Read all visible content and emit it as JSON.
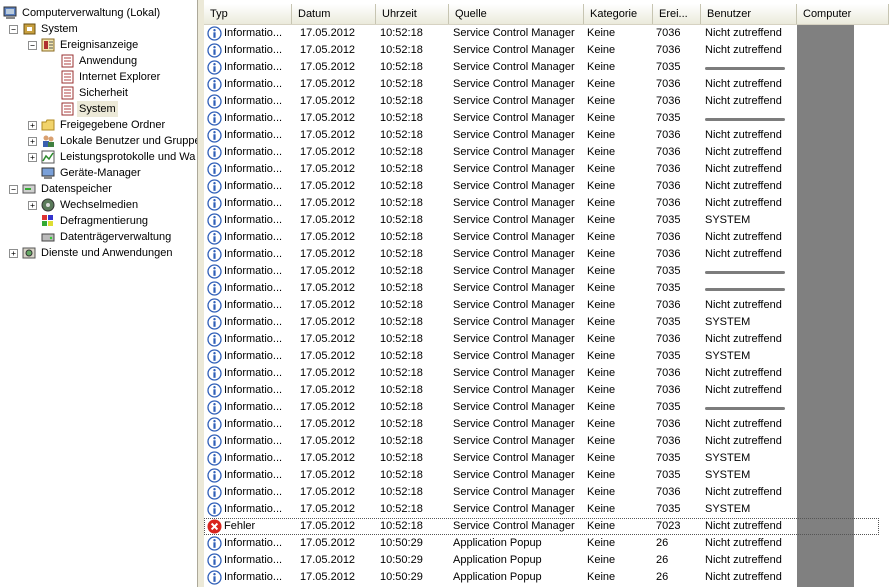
{
  "tree": {
    "items": [
      {
        "label": "Computerverwaltung (Lokal)",
        "icon": "computer-icon",
        "expander": "",
        "level": 0,
        "selected": false
      },
      {
        "label": "System",
        "icon": "tools-icon",
        "expander": "-",
        "level": 1,
        "selected": false
      },
      {
        "label": "Ereignisanzeige",
        "icon": "event-viewer-icon",
        "expander": "-",
        "level": 2,
        "selected": false
      },
      {
        "label": "Anwendung",
        "icon": "log-icon",
        "expander": "",
        "level": 3,
        "selected": false
      },
      {
        "label": "Internet Explorer",
        "icon": "log-icon",
        "expander": "",
        "level": 3,
        "selected": false
      },
      {
        "label": "Sicherheit",
        "icon": "log-icon",
        "expander": "",
        "level": 3,
        "selected": false
      },
      {
        "label": "System",
        "icon": "log-icon",
        "expander": "",
        "level": 3,
        "selected": true
      },
      {
        "label": "Freigegebene Ordner",
        "icon": "folder-icon",
        "expander": "+",
        "level": 2,
        "selected": false
      },
      {
        "label": "Lokale Benutzer und Gruppe",
        "icon": "users-icon",
        "expander": "+",
        "level": 2,
        "selected": false
      },
      {
        "label": "Leistungsprotokolle und Wa",
        "icon": "performance-icon",
        "expander": "+",
        "level": 2,
        "selected": false
      },
      {
        "label": "Geräte-Manager",
        "icon": "device-manager-icon",
        "expander": "",
        "level": 2,
        "selected": false
      },
      {
        "label": "Datenspeicher",
        "icon": "storage-icon",
        "expander": "-",
        "level": 1,
        "selected": false
      },
      {
        "label": "Wechselmedien",
        "icon": "removable-media-icon",
        "expander": "+",
        "level": 2,
        "selected": false
      },
      {
        "label": "Defragmentierung",
        "icon": "defrag-icon",
        "expander": "",
        "level": 2,
        "selected": false
      },
      {
        "label": "Datenträgerverwaltung",
        "icon": "disk-management-icon",
        "expander": "",
        "level": 2,
        "selected": false
      },
      {
        "label": "Dienste und Anwendungen",
        "icon": "services-icon",
        "expander": "+",
        "level": 1,
        "selected": false
      }
    ]
  },
  "list": {
    "columns": [
      {
        "key": "typ",
        "label": "Typ"
      },
      {
        "key": "datum",
        "label": "Datum"
      },
      {
        "key": "uhrzeit",
        "label": "Uhrzeit"
      },
      {
        "key": "quelle",
        "label": "Quelle"
      },
      {
        "key": "kategorie",
        "label": "Kategorie"
      },
      {
        "key": "ereignis",
        "label": "Erei..."
      },
      {
        "key": "benutzer",
        "label": "Benutzer"
      },
      {
        "key": "computer",
        "label": "Computer"
      }
    ],
    "rows": [
      {
        "typ": "Informatio...",
        "kind": "info",
        "datum": "17.05.2012",
        "uhrzeit": "10:52:18",
        "quelle": "Service Control Manager",
        "kategorie": "Keine",
        "ereignis": "7036",
        "benutzer": "Nicht zutreffend"
      },
      {
        "typ": "Informatio...",
        "kind": "info",
        "datum": "17.05.2012",
        "uhrzeit": "10:52:18",
        "quelle": "Service Control Manager",
        "kategorie": "Keine",
        "ereignis": "7036",
        "benutzer": "Nicht zutreffend"
      },
      {
        "typ": "Informatio...",
        "kind": "info",
        "datum": "17.05.2012",
        "uhrzeit": "10:52:18",
        "quelle": "Service Control Manager",
        "kategorie": "Keine",
        "ereignis": "7035",
        "benutzer": "",
        "redacted": true
      },
      {
        "typ": "Informatio...",
        "kind": "info",
        "datum": "17.05.2012",
        "uhrzeit": "10:52:18",
        "quelle": "Service Control Manager",
        "kategorie": "Keine",
        "ereignis": "7036",
        "benutzer": "Nicht zutreffend"
      },
      {
        "typ": "Informatio...",
        "kind": "info",
        "datum": "17.05.2012",
        "uhrzeit": "10:52:18",
        "quelle": "Service Control Manager",
        "kategorie": "Keine",
        "ereignis": "7036",
        "benutzer": "Nicht zutreffend"
      },
      {
        "typ": "Informatio...",
        "kind": "info",
        "datum": "17.05.2012",
        "uhrzeit": "10:52:18",
        "quelle": "Service Control Manager",
        "kategorie": "Keine",
        "ereignis": "7035",
        "benutzer": "",
        "redacted": true
      },
      {
        "typ": "Informatio...",
        "kind": "info",
        "datum": "17.05.2012",
        "uhrzeit": "10:52:18",
        "quelle": "Service Control Manager",
        "kategorie": "Keine",
        "ereignis": "7036",
        "benutzer": "Nicht zutreffend"
      },
      {
        "typ": "Informatio...",
        "kind": "info",
        "datum": "17.05.2012",
        "uhrzeit": "10:52:18",
        "quelle": "Service Control Manager",
        "kategorie": "Keine",
        "ereignis": "7036",
        "benutzer": "Nicht zutreffend"
      },
      {
        "typ": "Informatio...",
        "kind": "info",
        "datum": "17.05.2012",
        "uhrzeit": "10:52:18",
        "quelle": "Service Control Manager",
        "kategorie": "Keine",
        "ereignis": "7036",
        "benutzer": "Nicht zutreffend"
      },
      {
        "typ": "Informatio...",
        "kind": "info",
        "datum": "17.05.2012",
        "uhrzeit": "10:52:18",
        "quelle": "Service Control Manager",
        "kategorie": "Keine",
        "ereignis": "7036",
        "benutzer": "Nicht zutreffend"
      },
      {
        "typ": "Informatio...",
        "kind": "info",
        "datum": "17.05.2012",
        "uhrzeit": "10:52:18",
        "quelle": "Service Control Manager",
        "kategorie": "Keine",
        "ereignis": "7036",
        "benutzer": "Nicht zutreffend"
      },
      {
        "typ": "Informatio...",
        "kind": "info",
        "datum": "17.05.2012",
        "uhrzeit": "10:52:18",
        "quelle": "Service Control Manager",
        "kategorie": "Keine",
        "ereignis": "7035",
        "benutzer": "SYSTEM"
      },
      {
        "typ": "Informatio...",
        "kind": "info",
        "datum": "17.05.2012",
        "uhrzeit": "10:52:18",
        "quelle": "Service Control Manager",
        "kategorie": "Keine",
        "ereignis": "7036",
        "benutzer": "Nicht zutreffend"
      },
      {
        "typ": "Informatio...",
        "kind": "info",
        "datum": "17.05.2012",
        "uhrzeit": "10:52:18",
        "quelle": "Service Control Manager",
        "kategorie": "Keine",
        "ereignis": "7036",
        "benutzer": "Nicht zutreffend"
      },
      {
        "typ": "Informatio...",
        "kind": "info",
        "datum": "17.05.2012",
        "uhrzeit": "10:52:18",
        "quelle": "Service Control Manager",
        "kategorie": "Keine",
        "ereignis": "7035",
        "benutzer": "",
        "redacted": true
      },
      {
        "typ": "Informatio...",
        "kind": "info",
        "datum": "17.05.2012",
        "uhrzeit": "10:52:18",
        "quelle": "Service Control Manager",
        "kategorie": "Keine",
        "ereignis": "7035",
        "benutzer": "",
        "redacted": true
      },
      {
        "typ": "Informatio...",
        "kind": "info",
        "datum": "17.05.2012",
        "uhrzeit": "10:52:18",
        "quelle": "Service Control Manager",
        "kategorie": "Keine",
        "ereignis": "7036",
        "benutzer": "Nicht zutreffend"
      },
      {
        "typ": "Informatio...",
        "kind": "info",
        "datum": "17.05.2012",
        "uhrzeit": "10:52:18",
        "quelle": "Service Control Manager",
        "kategorie": "Keine",
        "ereignis": "7035",
        "benutzer": "SYSTEM"
      },
      {
        "typ": "Informatio...",
        "kind": "info",
        "datum": "17.05.2012",
        "uhrzeit": "10:52:18",
        "quelle": "Service Control Manager",
        "kategorie": "Keine",
        "ereignis": "7036",
        "benutzer": "Nicht zutreffend"
      },
      {
        "typ": "Informatio...",
        "kind": "info",
        "datum": "17.05.2012",
        "uhrzeit": "10:52:18",
        "quelle": "Service Control Manager",
        "kategorie": "Keine",
        "ereignis": "7035",
        "benutzer": "SYSTEM"
      },
      {
        "typ": "Informatio...",
        "kind": "info",
        "datum": "17.05.2012",
        "uhrzeit": "10:52:18",
        "quelle": "Service Control Manager",
        "kategorie": "Keine",
        "ereignis": "7036",
        "benutzer": "Nicht zutreffend"
      },
      {
        "typ": "Informatio...",
        "kind": "info",
        "datum": "17.05.2012",
        "uhrzeit": "10:52:18",
        "quelle": "Service Control Manager",
        "kategorie": "Keine",
        "ereignis": "7036",
        "benutzer": "Nicht zutreffend"
      },
      {
        "typ": "Informatio...",
        "kind": "info",
        "datum": "17.05.2012",
        "uhrzeit": "10:52:18",
        "quelle": "Service Control Manager",
        "kategorie": "Keine",
        "ereignis": "7035",
        "benutzer": "",
        "redacted": true
      },
      {
        "typ": "Informatio...",
        "kind": "info",
        "datum": "17.05.2012",
        "uhrzeit": "10:52:18",
        "quelle": "Service Control Manager",
        "kategorie": "Keine",
        "ereignis": "7036",
        "benutzer": "Nicht zutreffend"
      },
      {
        "typ": "Informatio...",
        "kind": "info",
        "datum": "17.05.2012",
        "uhrzeit": "10:52:18",
        "quelle": "Service Control Manager",
        "kategorie": "Keine",
        "ereignis": "7036",
        "benutzer": "Nicht zutreffend"
      },
      {
        "typ": "Informatio...",
        "kind": "info",
        "datum": "17.05.2012",
        "uhrzeit": "10:52:18",
        "quelle": "Service Control Manager",
        "kategorie": "Keine",
        "ereignis": "7035",
        "benutzer": "SYSTEM"
      },
      {
        "typ": "Informatio...",
        "kind": "info",
        "datum": "17.05.2012",
        "uhrzeit": "10:52:18",
        "quelle": "Service Control Manager",
        "kategorie": "Keine",
        "ereignis": "7035",
        "benutzer": "SYSTEM"
      },
      {
        "typ": "Informatio...",
        "kind": "info",
        "datum": "17.05.2012",
        "uhrzeit": "10:52:18",
        "quelle": "Service Control Manager",
        "kategorie": "Keine",
        "ereignis": "7036",
        "benutzer": "Nicht zutreffend"
      },
      {
        "typ": "Informatio...",
        "kind": "info",
        "datum": "17.05.2012",
        "uhrzeit": "10:52:18",
        "quelle": "Service Control Manager",
        "kategorie": "Keine",
        "ereignis": "7035",
        "benutzer": "SYSTEM"
      },
      {
        "typ": "Fehler",
        "kind": "error",
        "datum": "17.05.2012",
        "uhrzeit": "10:52:18",
        "quelle": "Service Control Manager",
        "kategorie": "Keine",
        "ereignis": "7023",
        "benutzer": "Nicht zutreffend",
        "focused": true
      },
      {
        "typ": "Informatio...",
        "kind": "info",
        "datum": "17.05.2012",
        "uhrzeit": "10:50:29",
        "quelle": "Application Popup",
        "kategorie": "Keine",
        "ereignis": "26",
        "benutzer": "Nicht zutreffend"
      },
      {
        "typ": "Informatio...",
        "kind": "info",
        "datum": "17.05.2012",
        "uhrzeit": "10:50:29",
        "quelle": "Application Popup",
        "kategorie": "Keine",
        "ereignis": "26",
        "benutzer": "Nicht zutreffend"
      },
      {
        "typ": "Informatio...",
        "kind": "info",
        "datum": "17.05.2012",
        "uhrzeit": "10:50:29",
        "quelle": "Application Popup",
        "kategorie": "Keine",
        "ereignis": "26",
        "benutzer": "Nicht zutreffend"
      }
    ]
  },
  "colors": {
    "info_icon": "#2f5fb8",
    "error_icon": "#d8241c",
    "header_bg": "#ebeadb",
    "redaction": "#808080"
  }
}
